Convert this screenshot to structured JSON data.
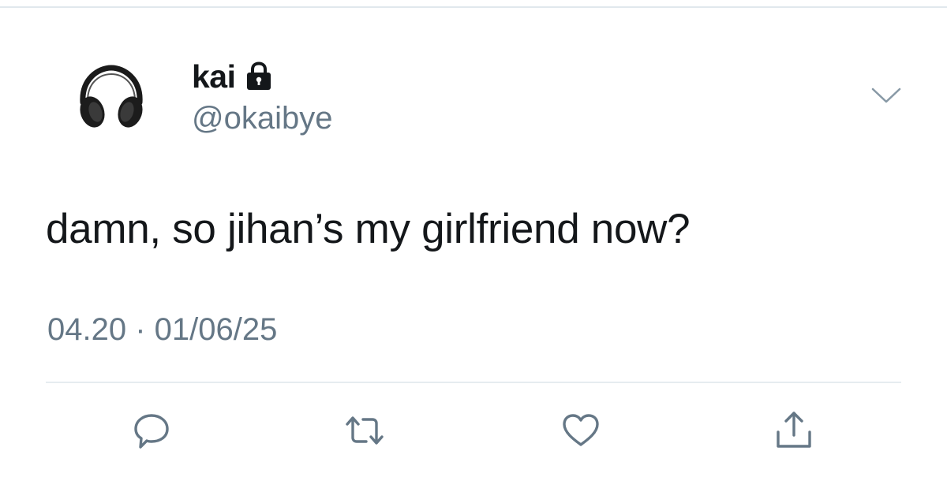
{
  "tweet": {
    "author": {
      "display_name": "kai",
      "handle": "@okaibye",
      "protected_icon": "lock-icon",
      "avatar_icon": "headphones-avatar"
    },
    "text": "damn, so jihan’s my girlfriend now?",
    "timestamp": "04.20 · 01/06/25",
    "menu_icon": "chevron-down-icon",
    "actions": [
      {
        "name": "reply",
        "icon": "reply-icon"
      },
      {
        "name": "retweet",
        "icon": "retweet-icon"
      },
      {
        "name": "like",
        "icon": "heart-icon"
      },
      {
        "name": "share",
        "icon": "share-icon"
      }
    ]
  },
  "colors": {
    "text_primary": "#14171a",
    "text_secondary": "#657786",
    "icon": "#657786",
    "divider": "#e6ecf0"
  }
}
